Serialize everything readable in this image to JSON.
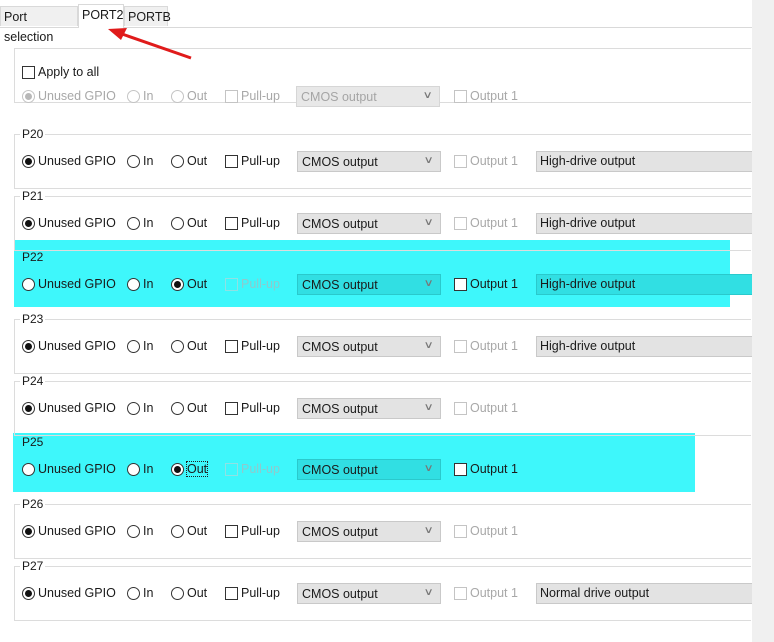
{
  "tabs": [
    {
      "label": "Port selection"
    },
    {
      "label": "PORT2"
    },
    {
      "label": "PORTB"
    }
  ],
  "apply_all": {
    "label": "Apply to all",
    "mode_unused": "Unused GPIO",
    "mode_in": "In",
    "mode_out": "Out",
    "pullup": "Pull-up",
    "output_type": "CMOS output",
    "output1": "Output 1"
  },
  "pins": [
    {
      "name": "P20",
      "unused": "Unused GPIO",
      "in": "In",
      "out": "Out",
      "pullup": "Pull-up",
      "output_type": "CMOS output",
      "output1": "Output 1",
      "drive": "High-drive output",
      "mode": "unused"
    },
    {
      "name": "P21",
      "unused": "Unused GPIO",
      "in": "In",
      "out": "Out",
      "pullup": "Pull-up",
      "output_type": "CMOS output",
      "output1": "Output 1",
      "drive": "High-drive output",
      "mode": "unused"
    },
    {
      "name": "P22",
      "unused": "Unused GPIO",
      "in": "In",
      "out": "Out",
      "pullup": "Pull-up",
      "output_type": "CMOS output",
      "output1": "Output 1",
      "drive": "High-drive output",
      "mode": "out",
      "highlighted": true
    },
    {
      "name": "P23",
      "unused": "Unused GPIO",
      "in": "In",
      "out": "Out",
      "pullup": "Pull-up",
      "output_type": "CMOS output",
      "output1": "Output 1",
      "drive": "High-drive output",
      "mode": "unused"
    },
    {
      "name": "P24",
      "unused": "Unused GPIO",
      "in": "In",
      "out": "Out",
      "pullup": "Pull-up",
      "output_type": "CMOS output",
      "output1": "Output 1",
      "drive": "",
      "mode": "unused"
    },
    {
      "name": "P25",
      "unused": "Unused GPIO",
      "in": "In",
      "out": "Out",
      "pullup": "Pull-up",
      "output_type": "CMOS output",
      "output1": "Output 1",
      "drive": "",
      "mode": "out",
      "highlighted": true,
      "focused": true
    },
    {
      "name": "P26",
      "unused": "Unused GPIO",
      "in": "In",
      "out": "Out",
      "pullup": "Pull-up",
      "output_type": "CMOS output",
      "output1": "Output 1",
      "drive": "",
      "mode": "unused"
    },
    {
      "name": "P27",
      "unused": "Unused GPIO",
      "in": "In",
      "out": "Out",
      "pullup": "Pull-up",
      "output_type": "CMOS output",
      "output1": "Output 1",
      "drive": "Normal drive output",
      "mode": "unused"
    }
  ],
  "icons": {
    "dropdown": "chevron-down-icon",
    "annotation": "red-arrow-icon"
  },
  "colors": {
    "highlight": "#3ef7fb",
    "arrow": "#e01b1b"
  }
}
